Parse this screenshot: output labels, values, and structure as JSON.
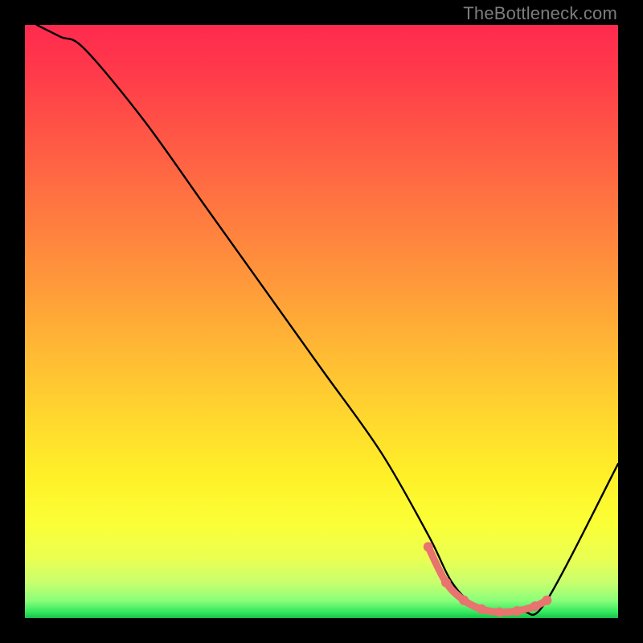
{
  "watermark": "TheBottleneck.com",
  "chart_data": {
    "type": "line",
    "title": "",
    "xlabel": "",
    "ylabel": "",
    "xlim": [
      0,
      100
    ],
    "ylim": [
      0,
      100
    ],
    "grid": false,
    "legend": false,
    "series": [
      {
        "name": "bottleneck-curve",
        "color": "#000000",
        "x": [
          2,
          6,
          10,
          20,
          30,
          40,
          50,
          60,
          68,
          72,
          76,
          80,
          84,
          88,
          100
        ],
        "y": [
          100,
          98,
          96,
          84,
          70,
          56,
          42,
          28,
          14,
          6,
          2,
          1,
          1,
          3,
          26
        ]
      },
      {
        "name": "highlight-segment",
        "color": "#e8736f",
        "x": [
          68,
          71,
          74,
          77,
          80,
          83,
          86,
          88
        ],
        "y": [
          12,
          6,
          3,
          1.5,
          1,
          1.2,
          2,
          3
        ]
      }
    ],
    "background_gradient_top": "#ff2a4f",
    "background_gradient_mid": "#ffd72e",
    "background_gradient_bottom": "#18c04a"
  }
}
